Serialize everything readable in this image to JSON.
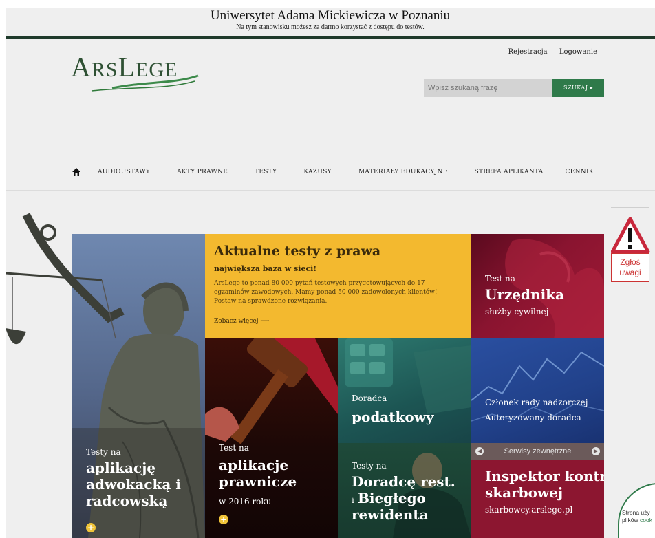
{
  "banner": {
    "title": "Uniwersytet Adama Mickiewicza w Poznaniu",
    "subtitle": "Na tym stanowisku możesz za darmo korzystać z dostępu do testów."
  },
  "header": {
    "logo_first": "A",
    "logo_rest1": "RS",
    "logo_L": "L",
    "logo_rest2": "EGE",
    "register": "Rejestracja",
    "login": "Logowanie",
    "search_placeholder": "Wpisz szukaną frazę",
    "search_button": "SZUKAJ ▸"
  },
  "nav": {
    "items": [
      "AUDIOUSTAWY",
      "AKTY PRAWNE",
      "TESTY",
      "KAZUSY",
      "MATERIAŁY EDUKACYJNE",
      "STREFA APLIKANTA",
      "CENNIK"
    ]
  },
  "tiles": {
    "yellow": {
      "title": "Aktualne testy z prawa",
      "subtitle": "największa baza w sieci!",
      "body": "ArsLege to ponad 80 000 pytań testowych przygotowujących do 17 egzaminów zawodowych. Mamy ponad 50 000 zadowolonych klientów! Postaw na sprawdzone rozwiązania.",
      "more": "Zobacz więcej ⟶"
    },
    "urzednik": {
      "small": "Test na",
      "big": "Urzędnika",
      "sub": "służby cywilnej"
    },
    "adwokacka": {
      "small": "Testy na",
      "big1": "aplikację",
      "big2": "adwokacką i",
      "big3": "radcowską"
    },
    "prawnicze": {
      "small": "Test na",
      "big1": "aplikacje",
      "big2": "prawnicze",
      "sub": "w 2016 roku"
    },
    "podatkowy": {
      "small": "Doradca",
      "big": "podatkowy"
    },
    "nadzorcza": {
      "line1": "Członek rady nadzorczej",
      "line2": "Autoryzowany doradca"
    },
    "bieglego": {
      "small": "Testy na",
      "big1": "Doradcę rest.",
      "prefix": "i",
      "big2": "Biegłego",
      "big3": "rewidenta"
    },
    "ext_services": "Serwisy zewnętrzne",
    "inspektor": {
      "big1": "Inspektor kontroli",
      "big2": "skarbowej",
      "sub": "skarbowcy.arslege.pl"
    }
  },
  "report": {
    "line1": "Zgłoś",
    "line2": "uwagi"
  },
  "cookie": {
    "line1": "Strona uży",
    "line2_a": "plików ",
    "line2_b": "cook"
  }
}
